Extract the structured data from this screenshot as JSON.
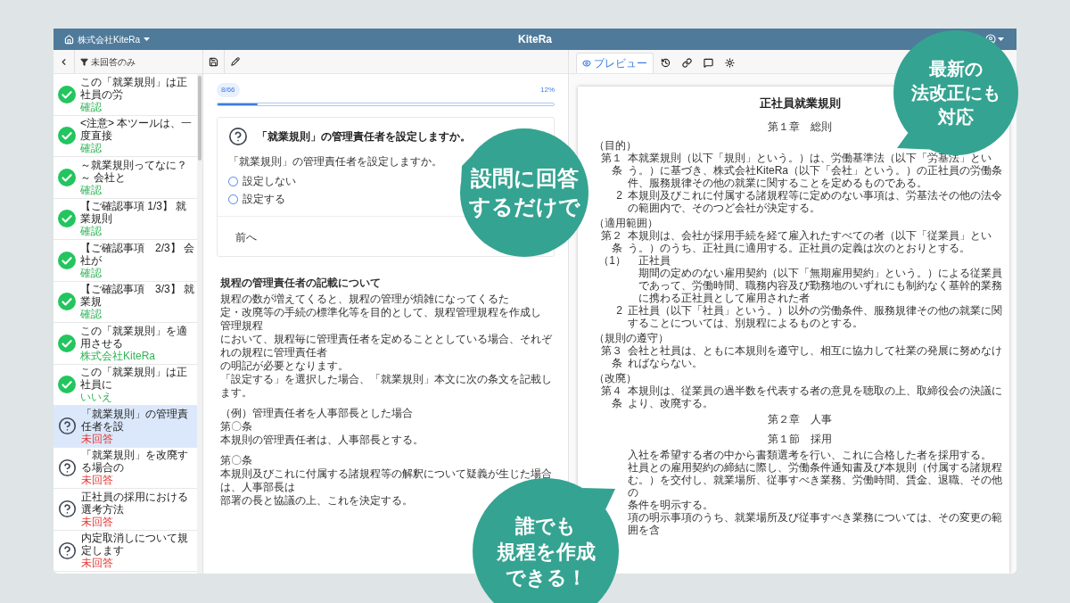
{
  "header": {
    "company": "株式会社KiteRa",
    "logo": "KiteRa"
  },
  "sidebar": {
    "filter": "未回答のみ",
    "items": [
      {
        "title": "この「就業規則」は正社員の労",
        "answer": "確認",
        "answered": true,
        "selected": false
      },
      {
        "title": "<注意> 本ツールは、一度直接",
        "answer": "確認",
        "answered": true,
        "selected": false
      },
      {
        "title": "～就業規則ってなに？～ 会社と",
        "answer": "確認",
        "answered": true,
        "selected": false
      },
      {
        "title": "【ご確認事項 1/3】 就業規則",
        "answer": "確認",
        "answered": true,
        "selected": false
      },
      {
        "title": "【ご確認事項　2/3】 会社が",
        "answer": "確認",
        "answered": true,
        "selected": false
      },
      {
        "title": "【ご確認事項　3/3】 就業規",
        "answer": "確認",
        "answered": true,
        "selected": false
      },
      {
        "title": "この「就業規則」を適用させる",
        "answer": "株式会社KiteRa",
        "answered": true,
        "selected": false
      },
      {
        "title": "この「就業規則」は正社員に",
        "answer": "いいえ",
        "answered": true,
        "selected": false
      },
      {
        "title": "「就業規則」の管理責任者を設",
        "answer": "未回答",
        "answered": false,
        "selected": true
      },
      {
        "title": "「就業規則」を改廃する場合の",
        "answer": "未回答",
        "answered": false,
        "selected": false
      },
      {
        "title": "正社員の採用における選考方法",
        "answer": "未回答",
        "answered": false,
        "selected": false
      },
      {
        "title": "内定取消しについて規定します",
        "answer": "未回答",
        "answered": false,
        "selected": false
      }
    ]
  },
  "progress": {
    "count": "8/66",
    "percent": "12%",
    "level": 0.12
  },
  "question": {
    "title": "「就業規則」の管理責任者を設定しますか。",
    "prompt": "「就業規則」の管理責任者を設定しますか。",
    "options": [
      {
        "label": "設定しない",
        "selected": false
      },
      {
        "label": "設定する",
        "selected": false
      }
    ],
    "back": "前へ"
  },
  "explanation": {
    "heading": "規程の管理責任者の記載について",
    "groups": [
      [
        {
          "text": "規程の数が増えてくると、規程の管理が煩雑になってくるた"
        },
        {
          "text": "定・改廃等の手続の標準化等を目的として、規程管理規程を作成し",
          "right": "管理規程"
        },
        {
          "text": "において、規程毎に管理責任者を定めることとしている場合、それぞれの規程に管理責任者"
        },
        {
          "text": "の明記が必要となります。"
        },
        {
          "text": "「設定する」を選択した場合、「就業規則」本文に次の条文を記載します。"
        }
      ],
      [
        {
          "text": "（例）管理責任者を人事部長とした場合"
        },
        {
          "text": "第〇条"
        },
        {
          "text": "本規則の管理責任者は、人事部長とする。"
        }
      ],
      [
        {
          "text": "第〇条"
        },
        {
          "text": "本規則及びこれに付属する諸規程等の解釈について疑義が生じた場合は、人事部長は"
        },
        {
          "text": "部署の長と協議の上、これを決定する。"
        }
      ]
    ]
  },
  "preview": {
    "tabs": [
      {
        "label": "プレビュー",
        "selected": true
      }
    ],
    "document": {
      "title": "正社員就業規則",
      "blocks": [
        {
          "kind": "chapter",
          "text": "第１章　総則"
        },
        {
          "kind": "heading",
          "text": "（目的）"
        },
        {
          "kind": "article",
          "label": "第１条",
          "text": "本就業規則（以下「規則」という。）は、労働基準法（以下「労基法」という。）に基づき、株式会社KiteRa（以下「会社」という。）の正社員の労働条件、服務規律その他の就業に関することを定めるものである。"
        },
        {
          "kind": "clause",
          "label": "2",
          "text": "本規則及びこれに付属する諸規程等に定めのない事項は、労基法その他の法令の範囲内で、そのつど会社が決定する。"
        },
        {
          "kind": "heading",
          "text": "（適用範囲）"
        },
        {
          "kind": "article",
          "label": "第２条",
          "text": "本規則は、会社が採用手続を経て雇入れたすべての者（以下「従業員」という。）のうち、正社員に適用する。正社員の定義は次のとおりとする。"
        },
        {
          "kind": "item",
          "label": "（1）",
          "text": "正社員"
        },
        {
          "kind": "itemtext",
          "text": "期間の定めのない雇用契約（以下「無期雇用契約」という。）による従業員であって、労働時間、職務内容及び勤務地のいずれにも制約なく基幹的業務に携わる正社員として雇用された者"
        },
        {
          "kind": "clause",
          "label": "2",
          "text": "正社員（以下「社員」という。）以外の労働条件、服務規律その他の就業に関することについては、別規程によるものとする。"
        },
        {
          "kind": "heading",
          "text": "（規則の遵守）"
        },
        {
          "kind": "article",
          "label": "第３条",
          "text": "会社と社員は、ともに本規則を遵守し、相互に協力して社業の発展に努めなければならない。"
        },
        {
          "kind": "heading",
          "text": "（改廃）"
        },
        {
          "kind": "article",
          "label": "第４条",
          "text": "本規則は、従業員の過半数を代表する者の意見を聴取の上、取締役会の決議により、改廃する。"
        },
        {
          "kind": "chapter",
          "text": "第２章　人事"
        },
        {
          "kind": "chapter",
          "text": "第１節　採用"
        },
        {
          "kind": "partial",
          "text": "入社を希望する者の中から書類選考を行い、これに合格した者を採用する。"
        },
        {
          "kind": "partial",
          "text": "社員との雇用契約の締結に際し、労働条件通知書及び本規則（付属する諸規程"
        },
        {
          "kind": "partial",
          "text": "む。）を交付し、就業場所、従事すべき業務、労働時間、賃金、退職、その他の"
        },
        {
          "kind": "partial",
          "text": "条件を明示する。"
        },
        {
          "kind": "partial",
          "text": "項の明示事項のうち、就業場所及び従事すべき業務については、その変更の範囲を含"
        }
      ]
    }
  },
  "bubbles": [
    {
      "lines": [
        "設問に回答",
        "するだけで"
      ]
    },
    {
      "lines": [
        "最新の",
        "法改正にも",
        "対応"
      ]
    },
    {
      "lines": [
        "誰でも",
        "規程を作成",
        "できる！"
      ]
    }
  ]
}
